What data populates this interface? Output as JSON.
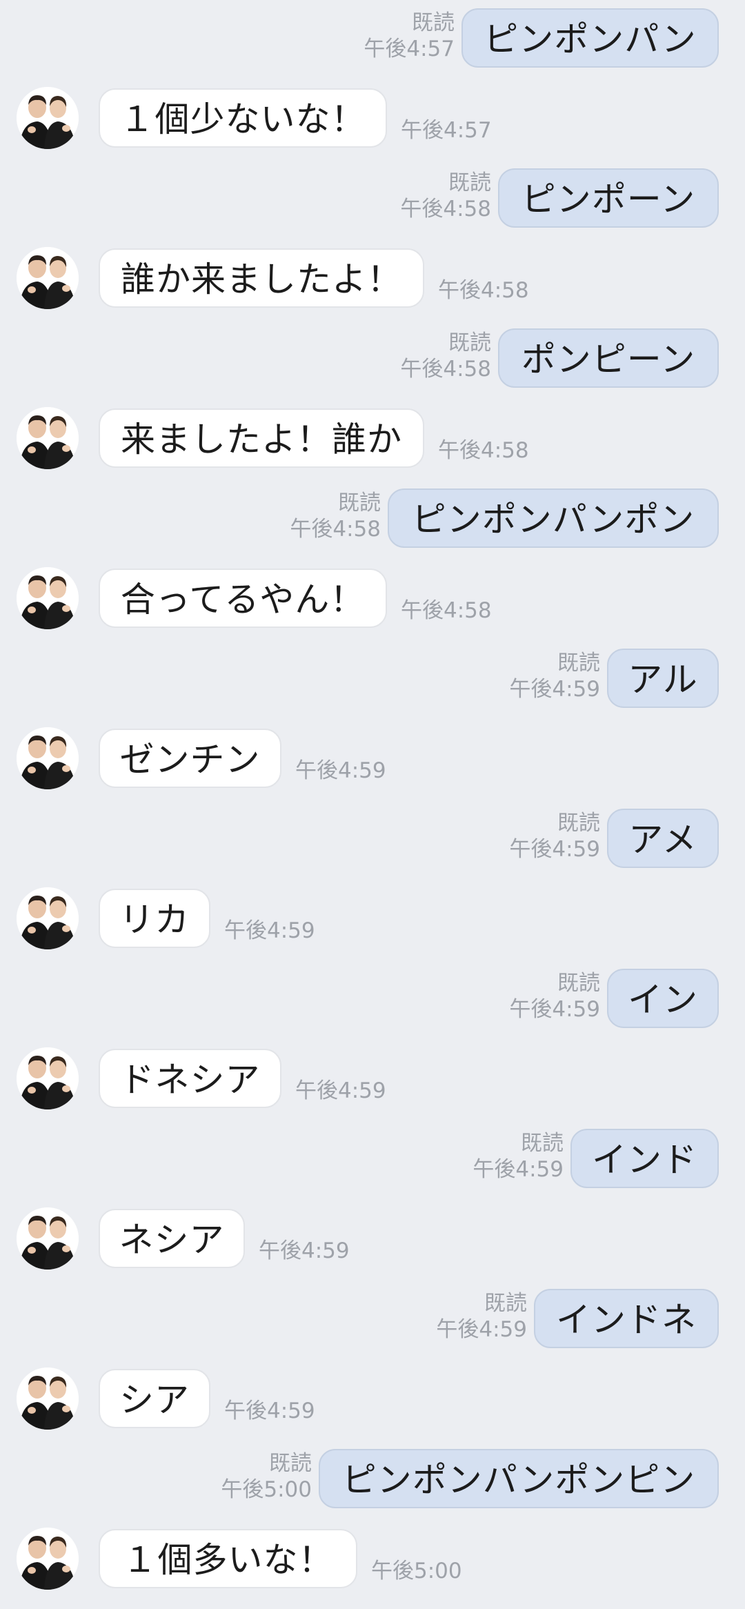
{
  "read_label": "既読",
  "contact": {
    "avatar_icon": "two-person-avatar-icon"
  },
  "messages": [
    {
      "side": "mine",
      "text": "ピンポンパン",
      "time": "午後4:57"
    },
    {
      "side": "theirs",
      "text": "１個少ないな！",
      "time": "午後4:57"
    },
    {
      "side": "mine",
      "text": "ピンポーン",
      "time": "午後4:58"
    },
    {
      "side": "theirs",
      "text": "誰か来ましたよ！",
      "time": "午後4:58"
    },
    {
      "side": "mine",
      "text": "ポンピーン",
      "time": "午後4:58"
    },
    {
      "side": "theirs",
      "text": "来ましたよ！誰か",
      "time": "午後4:58"
    },
    {
      "side": "mine",
      "text": "ピンポンパンポン",
      "time": "午後4:58"
    },
    {
      "side": "theirs",
      "text": "合ってるやん！",
      "time": "午後4:58"
    },
    {
      "side": "mine",
      "text": "アル",
      "time": "午後4:59"
    },
    {
      "side": "theirs",
      "text": "ゼンチン",
      "time": "午後4:59"
    },
    {
      "side": "mine",
      "text": "アメ",
      "time": "午後4:59"
    },
    {
      "side": "theirs",
      "text": "リカ",
      "time": "午後4:59"
    },
    {
      "side": "mine",
      "text": "イン",
      "time": "午後4:59"
    },
    {
      "side": "theirs",
      "text": "ドネシア",
      "time": "午後4:59"
    },
    {
      "side": "mine",
      "text": "インド",
      "time": "午後4:59"
    },
    {
      "side": "theirs",
      "text": "ネシア",
      "time": "午後4:59"
    },
    {
      "side": "mine",
      "text": "インドネ",
      "time": "午後4:59"
    },
    {
      "side": "theirs",
      "text": "シア",
      "time": "午後4:59"
    },
    {
      "side": "mine",
      "text": "ピンポンパンポンピン",
      "time": "午後5:00"
    },
    {
      "side": "theirs",
      "text": "１個多いな！",
      "time": "午後5:00"
    }
  ]
}
